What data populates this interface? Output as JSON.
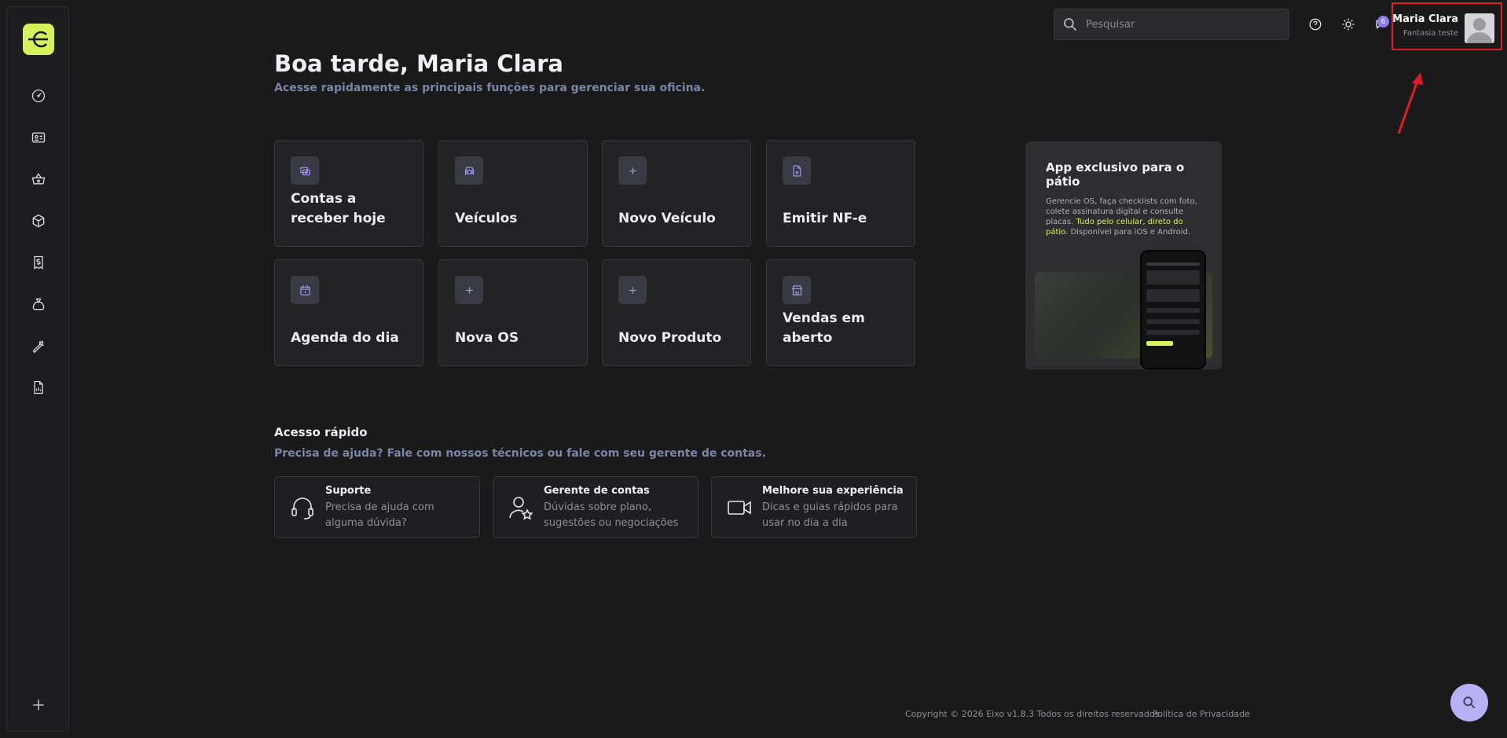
{
  "search": {
    "placeholder": "Pesquisar"
  },
  "user": {
    "name": "Maria Clara",
    "company": "Fantasia teste",
    "notifications": "6"
  },
  "header": {
    "greeting": "Boa tarde, Maria Clara",
    "subtitle": "Acesse rapidamente as principais funções para gerenciar sua oficina."
  },
  "quick_cards": [
    {
      "label": "Contas a receber hoje",
      "icon": "bills-icon"
    },
    {
      "label": "Veículos",
      "icon": "car-icon"
    },
    {
      "label": "Novo Veículo",
      "icon": "plus-icon"
    },
    {
      "label": "Emitir NF-e",
      "icon": "invoice-icon"
    },
    {
      "label": "Agenda do dia",
      "icon": "calendar-icon"
    },
    {
      "label": "Nova OS",
      "icon": "plus-icon"
    },
    {
      "label": "Novo Produto",
      "icon": "plus-icon"
    },
    {
      "label": "Vendas em aberto",
      "icon": "store-icon"
    }
  ],
  "promo": {
    "title": "App exclusivo para o pátio",
    "desc_start": "Gerencie OS, faça checklists com foto, colete assinatura digital e consulte placas. ",
    "desc_highlight": "Tudo pelo celular, direto do pátio.",
    "desc_end": " Disponível para iOS e Android."
  },
  "quick_access": {
    "title": "Acesso rápido",
    "subtitle": "Precisa de ajuda? Fale com nossos técnicos ou fale com seu gerente de contas.",
    "cards": [
      {
        "title": "Suporte",
        "desc": "Precisa de ajuda com alguma dúvida?"
      },
      {
        "title": "Gerente de contas",
        "desc": "Dúvidas sobre plano, sugestões ou negociações"
      },
      {
        "title": "Melhore sua experiência",
        "desc": "Dicas e guias rápidos para usar no dia a dia"
      }
    ]
  },
  "footer": {
    "copyright": "Copyright © 2026 Eixo v1.8.3 Todos os direitos reservados.",
    "privacy": "Política de Privacidade"
  },
  "sidebar": {
    "icons": [
      "dashboard-icon",
      "id-card-icon",
      "basket-icon",
      "box-icon",
      "receipt-icon",
      "money-bag-icon",
      "wrench-icon",
      "report-icon",
      "plus-icon"
    ]
  },
  "colors": {
    "brand": "#d5f25a",
    "accent": "#8b7cf6",
    "highlight_box": "#e01b24"
  }
}
